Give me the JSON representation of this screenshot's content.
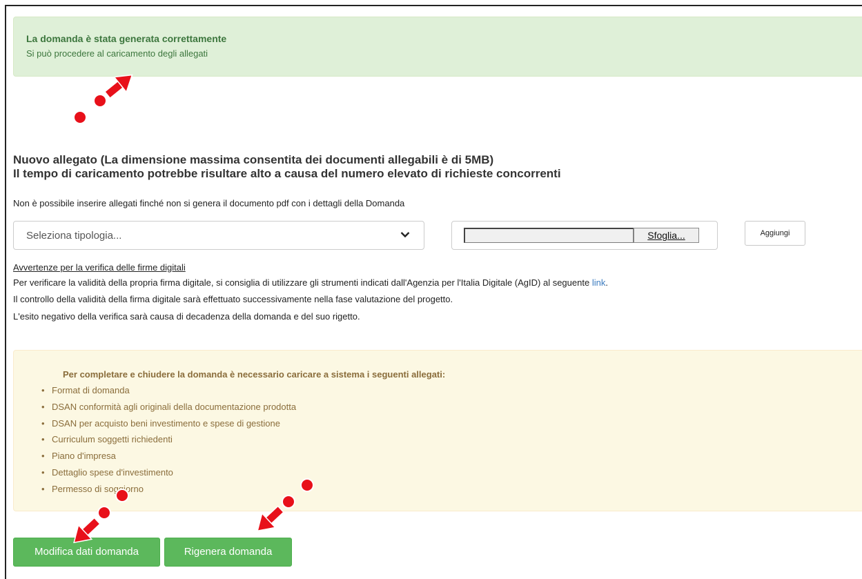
{
  "success_alert": {
    "title": "La domanda è stata generata correttamente",
    "text": "Si può procedere al caricamento degli allegati"
  },
  "upload": {
    "heading_line1": "Nuovo allegato (La dimensione massima consentita dei documenti allegabili è di 5MB)",
    "heading_line2": "Il tempo di caricamento potrebbe risultare alto a causa del numero elevato di richieste concorrenti",
    "note": "Non è possibile inserire allegati finché non si genera il documento pdf con i dettagli della Domanda",
    "select_placeholder": "Seleziona tipologia...",
    "browse_label": "Sfoglia...",
    "add_label": "Aggiungi"
  },
  "signature_warning": {
    "title": "Avvertenze per la verifica delle firme digitali",
    "line1": "Per verificare la validità della propria firma digitale, si consiglia di utilizzare gli strumenti indicati dall'Agenzia per l'Italia Digitale (AgID) al seguente ",
    "link_label": "link",
    "line1_end": ".",
    "line2": "Il controllo della validità della firma digitale sarà effettuato successivamente nella fase valutazione del progetto.",
    "line3": "L'esito negativo della verifica sarà causa di decadenza della domanda e del suo rigetto."
  },
  "required_attachments": {
    "title": "Per completare e chiudere la domanda è necessario caricare a sistema i seguenti allegati:",
    "items": [
      "Format di domanda",
      "DSAN conformità agli originali della documentazione prodotta",
      "DSAN per acquisto beni investimento e spese di gestione",
      "Curriculum soggetti richiedenti",
      "Piano d'impresa",
      "Dettaglio spese d'investimento",
      "Permesso di soggiorno"
    ]
  },
  "actions": {
    "edit_label": "Modifica dati domanda",
    "regenerate_label": "Rigenera domanda"
  },
  "colors": {
    "success_bg": "#dff0d8",
    "success_text": "#3c763d",
    "warning_bg": "#fcf8e3",
    "warning_text": "#8a6d3b",
    "button_green": "#5cb85c",
    "annotation_red": "#e8101a"
  }
}
